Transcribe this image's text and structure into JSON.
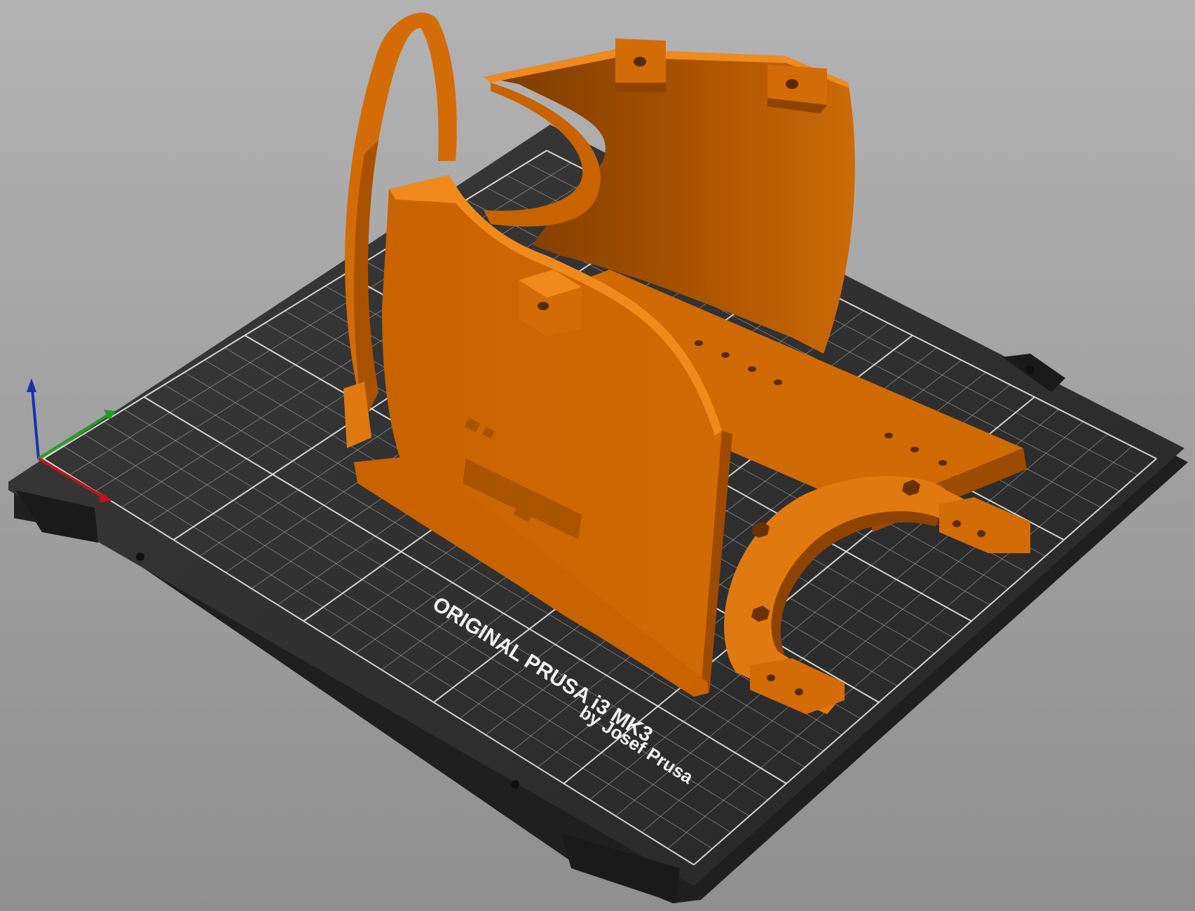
{
  "viewport": {
    "background_top": "#b3b3b3",
    "background_bottom": "#8f8f8f"
  },
  "bed": {
    "model_line1": "ORIGINAL PRUSA i3  MK3",
    "model_line2": "by Josef Prusa",
    "sheet_color": "#2e2e2e",
    "grid_color": "#e6e6e6"
  },
  "model": {
    "color": "#d96b00",
    "shade_dark": "#8f4300",
    "shade_light": "#f08a1c"
  },
  "axes": {
    "x_color": "#c0141a",
    "y_color": "#1fa11f",
    "z_color": "#1d2fb0"
  }
}
